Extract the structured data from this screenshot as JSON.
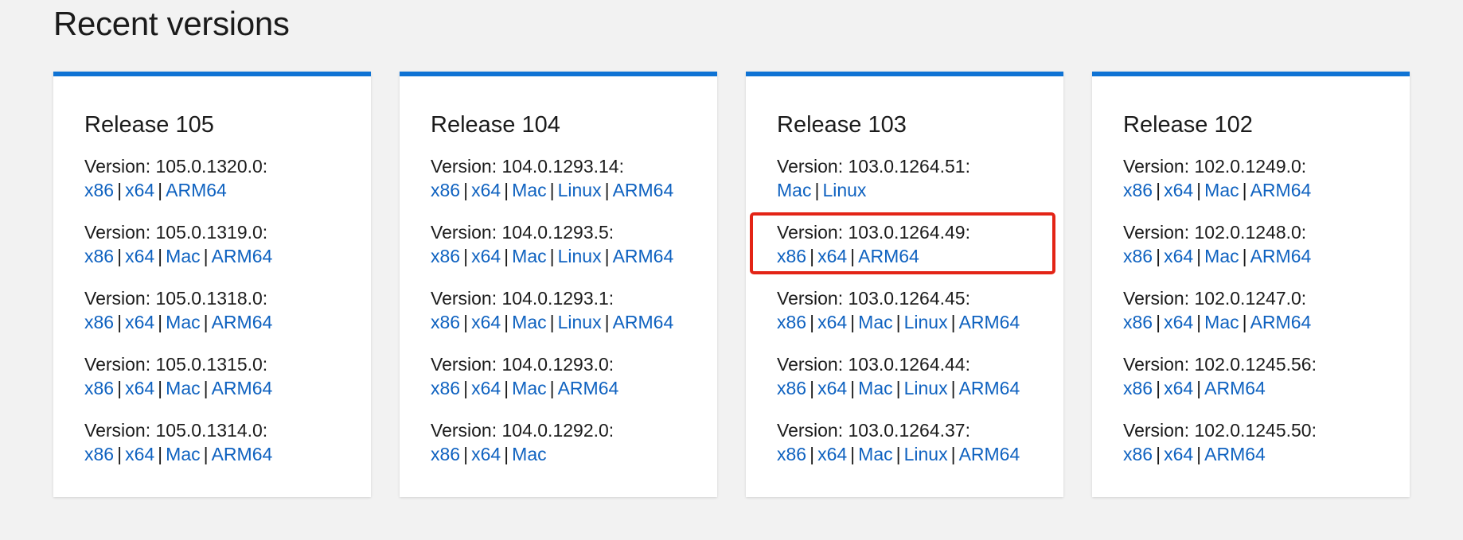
{
  "page": {
    "heading": "Recent versions"
  },
  "colors": {
    "accent_bar": "#0f73d4",
    "link": "#0f62c0",
    "highlight_box": "#e32416",
    "background": "#f2f2f2"
  },
  "separator": "|",
  "releases": [
    {
      "title": "Release 105",
      "versions": [
        {
          "label": "Version: 105.0.1320.0:",
          "links": [
            "x86",
            "x64",
            "ARM64"
          ],
          "highlighted": false
        },
        {
          "label": "Version: 105.0.1319.0:",
          "links": [
            "x86",
            "x64",
            "Mac",
            "ARM64"
          ],
          "highlighted": false
        },
        {
          "label": "Version: 105.0.1318.0:",
          "links": [
            "x86",
            "x64",
            "Mac",
            "ARM64"
          ],
          "highlighted": false
        },
        {
          "label": "Version: 105.0.1315.0:",
          "links": [
            "x86",
            "x64",
            "Mac",
            "ARM64"
          ],
          "highlighted": false
        },
        {
          "label": "Version: 105.0.1314.0:",
          "links": [
            "x86",
            "x64",
            "Mac",
            "ARM64"
          ],
          "highlighted": false
        }
      ]
    },
    {
      "title": "Release 104",
      "versions": [
        {
          "label": "Version: 104.0.1293.14:",
          "links": [
            "x86",
            "x64",
            "Mac",
            "Linux",
            "ARM64"
          ],
          "highlighted": false
        },
        {
          "label": "Version: 104.0.1293.5:",
          "links": [
            "x86",
            "x64",
            "Mac",
            "Linux",
            "ARM64"
          ],
          "highlighted": false
        },
        {
          "label": "Version: 104.0.1293.1:",
          "links": [
            "x86",
            "x64",
            "Mac",
            "Linux",
            "ARM64"
          ],
          "highlighted": false
        },
        {
          "label": "Version: 104.0.1293.0:",
          "links": [
            "x86",
            "x64",
            "Mac",
            "ARM64"
          ],
          "highlighted": false
        },
        {
          "label": "Version: 104.0.1292.0:",
          "links": [
            "x86",
            "x64",
            "Mac"
          ],
          "highlighted": false
        }
      ]
    },
    {
      "title": "Release 103",
      "versions": [
        {
          "label": "Version: 103.0.1264.51:",
          "links": [
            "Mac",
            "Linux"
          ],
          "highlighted": false
        },
        {
          "label": "Version: 103.0.1264.49:",
          "links": [
            "x86",
            "x64",
            "ARM64"
          ],
          "highlighted": true
        },
        {
          "label": "Version: 103.0.1264.45:",
          "links": [
            "x86",
            "x64",
            "Mac",
            "Linux",
            "ARM64"
          ],
          "highlighted": false
        },
        {
          "label": "Version: 103.0.1264.44:",
          "links": [
            "x86",
            "x64",
            "Mac",
            "Linux",
            "ARM64"
          ],
          "highlighted": false
        },
        {
          "label": "Version: 103.0.1264.37:",
          "links": [
            "x86",
            "x64",
            "Mac",
            "Linux",
            "ARM64"
          ],
          "highlighted": false
        }
      ]
    },
    {
      "title": "Release 102",
      "versions": [
        {
          "label": "Version: 102.0.1249.0:",
          "links": [
            "x86",
            "x64",
            "Mac",
            "ARM64"
          ],
          "highlighted": false
        },
        {
          "label": "Version: 102.0.1248.0:",
          "links": [
            "x86",
            "x64",
            "Mac",
            "ARM64"
          ],
          "highlighted": false
        },
        {
          "label": "Version: 102.0.1247.0:",
          "links": [
            "x86",
            "x64",
            "Mac",
            "ARM64"
          ],
          "highlighted": false
        },
        {
          "label": "Version: 102.0.1245.56:",
          "links": [
            "x86",
            "x64",
            "ARM64"
          ],
          "highlighted": false
        },
        {
          "label": "Version: 102.0.1245.50:",
          "links": [
            "x86",
            "x64",
            "ARM64"
          ],
          "highlighted": false
        }
      ]
    }
  ]
}
